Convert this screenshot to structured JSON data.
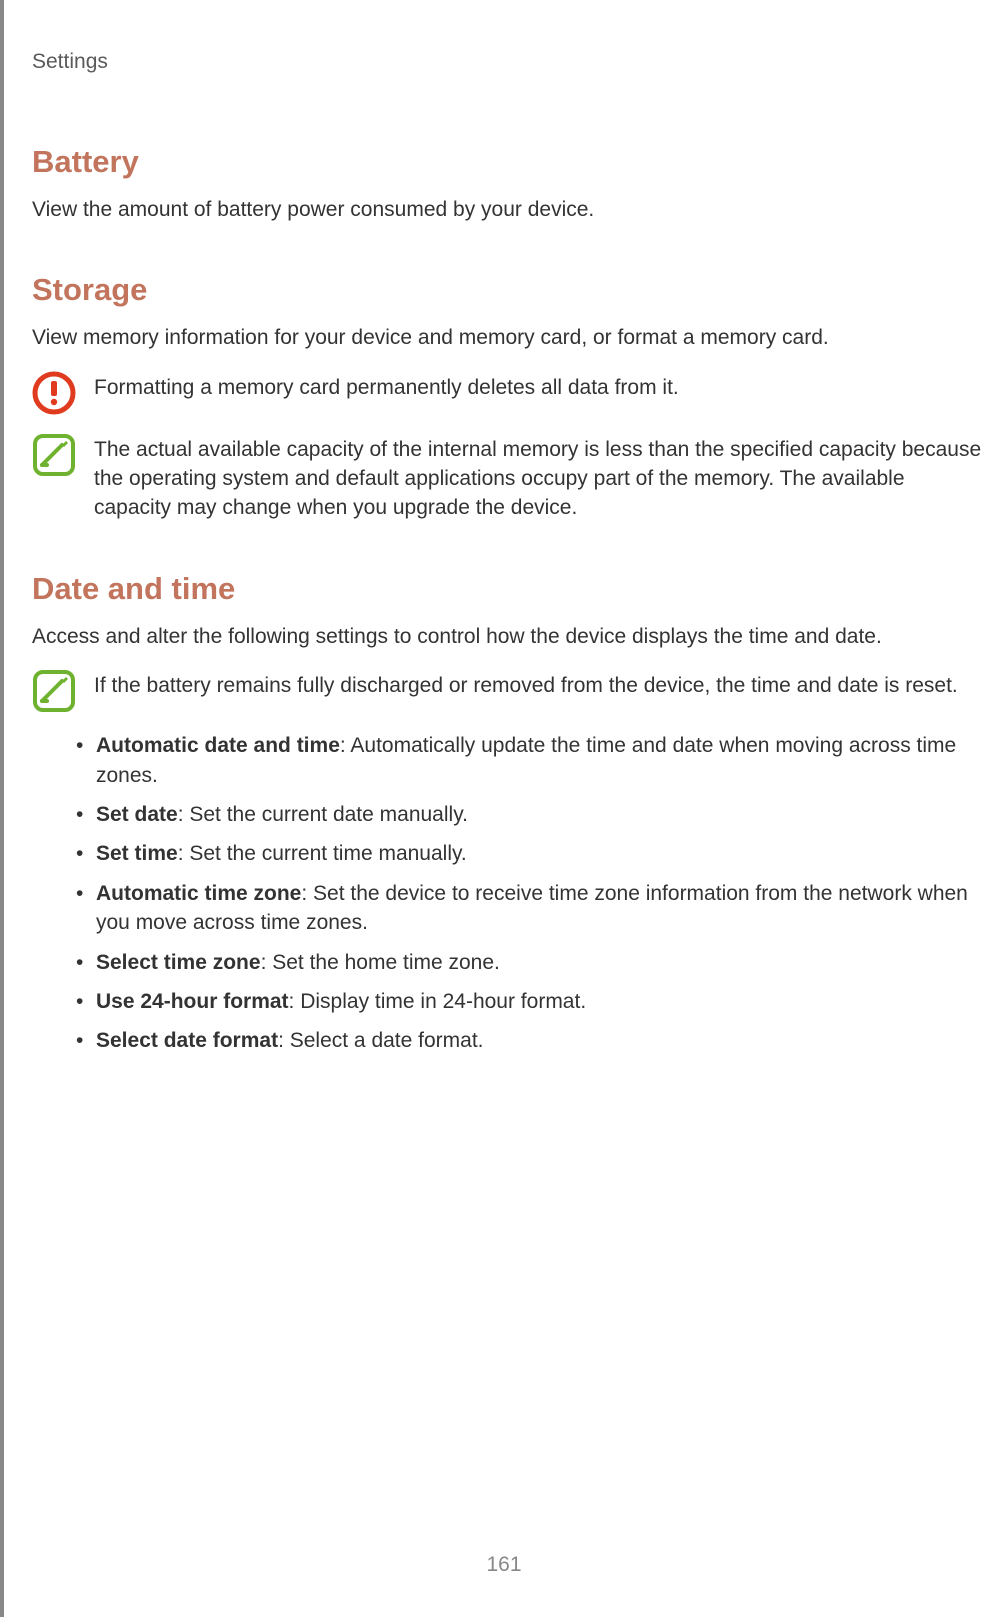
{
  "header": "Settings",
  "page_number": "161",
  "sections": [
    {
      "heading": "Battery",
      "intro": "View the amount of battery power consumed by your device."
    },
    {
      "heading": "Storage",
      "intro": "View memory information for your device and memory card, or format a memory card.",
      "callouts": [
        {
          "icon": "warning",
          "text": "Formatting a memory card permanently deletes all data from it."
        },
        {
          "icon": "note",
          "text": "The actual available capacity of the internal memory is less than the specified capacity because the operating system and default applications occupy part of the memory. The available capacity may change when you upgrade the device."
        }
      ]
    },
    {
      "heading": "Date and time",
      "intro": "Access and alter the following settings to control how the device displays the time and date.",
      "callouts": [
        {
          "icon": "note",
          "text": "If the battery remains fully discharged or removed from the device, the time and date is reset."
        }
      ],
      "bullets": [
        {
          "term": "Automatic date and time",
          "desc": ": Automatically update the time and date when moving across time zones."
        },
        {
          "term": "Set date",
          "desc": ": Set the current date manually."
        },
        {
          "term": "Set time",
          "desc": ": Set the current time manually."
        },
        {
          "term": "Automatic time zone",
          "desc": ": Set the device to receive time zone information from the network when you move across time zones."
        },
        {
          "term": "Select time zone",
          "desc": ": Set the home time zone."
        },
        {
          "term": "Use 24-hour format",
          "desc": ": Display time in 24-hour format."
        },
        {
          "term": "Select date format",
          "desc": ": Select a date format."
        }
      ]
    }
  ]
}
